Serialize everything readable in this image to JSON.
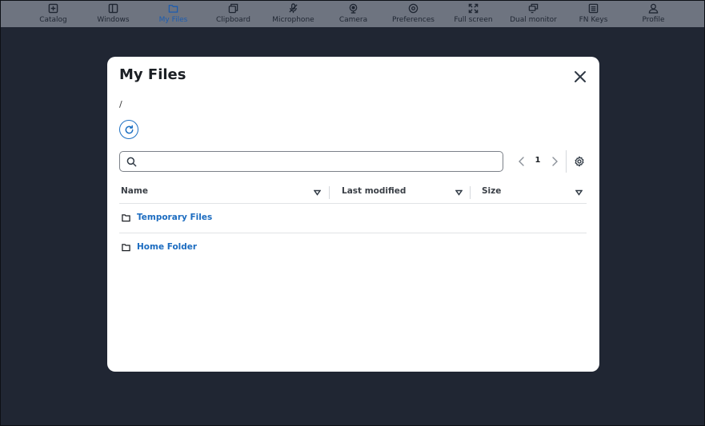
{
  "toolbar": {
    "items": [
      {
        "label": "Catalog",
        "icon": "plus-square-icon"
      },
      {
        "label": "Windows",
        "icon": "window-icon"
      },
      {
        "label": "My Files",
        "icon": "folder-icon",
        "active": true
      },
      {
        "label": "Clipboard",
        "icon": "clipboard-icon"
      },
      {
        "label": "Microphone",
        "icon": "microphone-icon"
      },
      {
        "label": "Camera",
        "icon": "camera-icon"
      },
      {
        "label": "Preferences",
        "icon": "gear-icon"
      },
      {
        "label": "Full screen",
        "icon": "fullscreen-icon"
      },
      {
        "label": "Dual monitor",
        "icon": "dual-monitor-icon"
      },
      {
        "label": "FN Keys",
        "icon": "keyboard-icon"
      },
      {
        "label": "Profile",
        "icon": "user-icon"
      }
    ]
  },
  "modal": {
    "title": "My Files",
    "path": "/",
    "search": {
      "value": "",
      "placeholder": ""
    },
    "pagination": {
      "current_page": "1"
    },
    "columns": {
      "name": "Name",
      "last_modified": "Last modified",
      "size": "Size"
    },
    "rows": [
      {
        "name": "Temporary Files",
        "type": "folder",
        "last_modified": "",
        "size": ""
      },
      {
        "name": "Home Folder",
        "type": "folder",
        "last_modified": "",
        "size": ""
      }
    ]
  },
  "colors": {
    "background": "#202633",
    "toolbar": "#6e7480",
    "accent": "#1c6cc0",
    "modal": "#ffffff"
  }
}
